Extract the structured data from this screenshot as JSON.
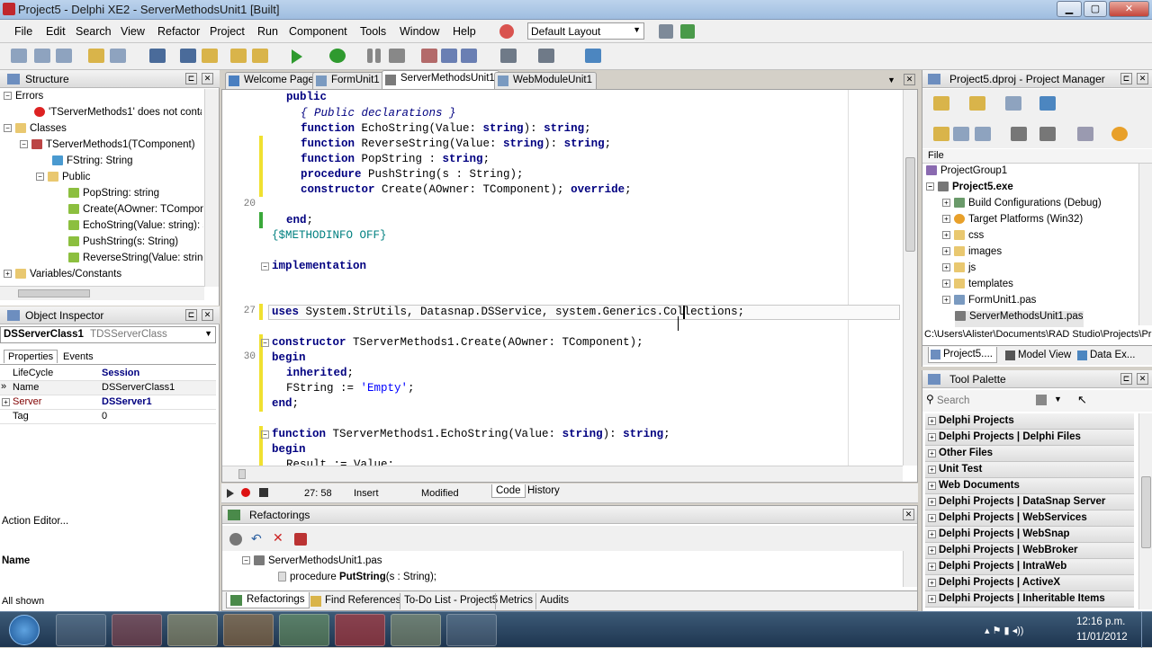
{
  "window": {
    "title": "Project5 - Delphi XE2 - ServerMethodsUnit1 [Built]"
  },
  "menu": [
    "File",
    "Edit",
    "Search",
    "View",
    "Refactor",
    "Project",
    "Run",
    "Component",
    "Tools",
    "Window",
    "Help"
  ],
  "layout_select": "Default Layout",
  "structure": {
    "title": "Structure",
    "items": [
      {
        "label": "Errors"
      },
      {
        "label": "'TServerMethods1' does not contai"
      },
      {
        "label": "Classes"
      },
      {
        "label": "TServerMethods1(TComponent)"
      },
      {
        "label": "FString: String"
      },
      {
        "label": "Public"
      },
      {
        "label": "PopString: string"
      },
      {
        "label": "Create(AOwner: TCompone"
      },
      {
        "label": "EchoString(Value: string): s"
      },
      {
        "label": "PushString(s: String)"
      },
      {
        "label": "ReverseString(Value: string"
      },
      {
        "label": "Variables/Constants"
      }
    ]
  },
  "inspector": {
    "title": "Object Inspector",
    "object": "DSServerClass1",
    "object_type": "TDSServerClass",
    "tabs": [
      "Properties",
      "Events"
    ],
    "rows": [
      {
        "k": "LifeCycle",
        "v": "Session"
      },
      {
        "k": "Name",
        "v": "DSServerClass1"
      },
      {
        "k": "Server",
        "v": "DSServer1"
      },
      {
        "k": "Tag",
        "v": "0"
      }
    ],
    "action_editor": "Action Editor...",
    "name_label": "Name",
    "all_shown": "All shown"
  },
  "tabs": [
    "Welcome Page",
    "FormUnit1",
    "ServerMethodsUnit1",
    "WebModuleUnit1"
  ],
  "editor": {
    "gutter": [
      "20",
      "27",
      "30"
    ],
    "cursor_pos": "27: 58",
    "mode": "Insert",
    "modified": "Modified",
    "view_tabs": [
      "Code",
      "History"
    ]
  },
  "code": [
    {
      "k": "public"
    },
    {
      "c": "{ Public declarations }"
    },
    {
      "a": "function",
      "b": " EchoString(Value: ",
      "d": "string",
      "e": "): ",
      "f": "string",
      "g": ";"
    },
    {
      "a": "function",
      "b": " ReverseString(Value: ",
      "d": "string",
      "e": "): ",
      "f": "string",
      "g": ";"
    },
    {
      "a": "function",
      "b": " PopString : ",
      "d": "string",
      "e": ";"
    },
    {
      "a": "procedure",
      "b": " PushString(s : String);"
    },
    {
      "a": "constructor",
      "b": " Create(AOwner: TComponent); ",
      "d": "override",
      "e": ";"
    },
    {
      "a": "end",
      "b": ";"
    },
    {
      "dir": "{$METHODINFO OFF}"
    },
    {
      "a": "implementation"
    },
    {
      "a": "uses",
      "b": " System.StrUtils, Datasnap.DSService, system.Generics.Collections;"
    },
    {
      "a": "constructor",
      "b": " TServerMethods1.Create(AOwner: TComponent);"
    },
    {
      "a": "begin"
    },
    {
      "a": "inherited",
      "b": ";"
    },
    {
      "b": "FString := ",
      "s": "'Empty'",
      "e": ";"
    },
    {
      "a": "end",
      "b": ";"
    },
    {
      "a": "function",
      "b": " TServerMethods1.EchoString(Value: ",
      "d": "string",
      "e": "): ",
      "f": "string",
      "g": ";"
    },
    {
      "a": "begin"
    },
    {
      "b": "Result := Value;"
    }
  ],
  "refactorings": {
    "title": "Refactorings",
    "file": "ServerMethodsUnit1.pas",
    "proc_prefix": "procedure ",
    "proc_name": "PutString",
    "proc_suffix": "(s : String);"
  },
  "bottom_tabs": [
    "Refactorings",
    "Find References",
    "To-Do List - Project5",
    "Metrics",
    "Audits"
  ],
  "project_manager": {
    "title": "Project5.dproj - Project Manager",
    "file_col": "File",
    "items": [
      {
        "label": "ProjectGroup1"
      },
      {
        "label": "Project5.exe"
      },
      {
        "label": "Build Configurations (Debug)"
      },
      {
        "label": "Target Platforms (Win32)"
      },
      {
        "label": "css"
      },
      {
        "label": "images"
      },
      {
        "label": "js"
      },
      {
        "label": "templates"
      },
      {
        "label": "FormUnit1.pas"
      },
      {
        "label": "ServerMethodsUnit1.pas"
      }
    ],
    "path": "C:\\Users\\Alister\\Documents\\RAD Studio\\Projects\\Pro",
    "tabs": [
      "Project5....",
      "Model View",
      "Data Ex..."
    ]
  },
  "tool_palette": {
    "title": "Tool Palette",
    "search_placeholder": "Search",
    "categories": [
      "Delphi Projects",
      "Delphi Projects | Delphi Files",
      "Other Files",
      "Unit Test",
      "Web Documents",
      "Delphi Projects | DataSnap Server",
      "Delphi Projects | WebServices",
      "Delphi Projects | WebSnap",
      "Delphi Projects | WebBroker",
      "Delphi Projects | IntraWeb",
      "Delphi Projects | ActiveX",
      "Delphi Projects | Inheritable Items"
    ]
  },
  "taskbar": {
    "time": "12:16 p.m.",
    "date": "11/01/2012"
  }
}
